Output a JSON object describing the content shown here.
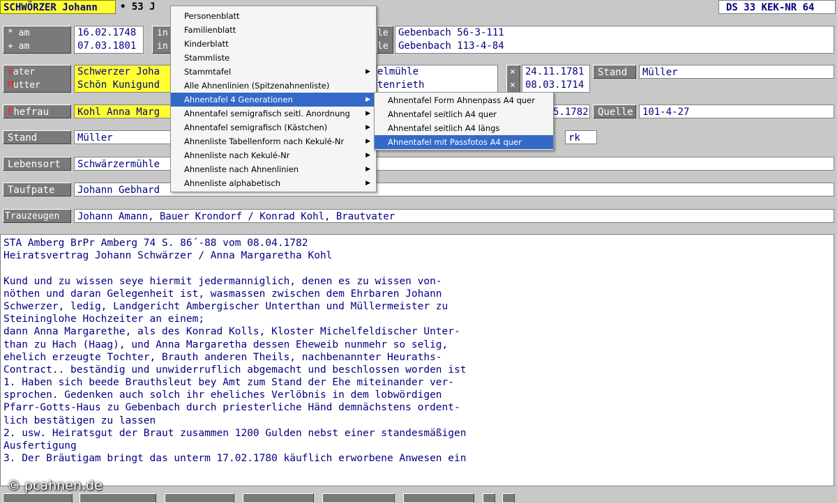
{
  "header": {
    "person_name": "SCHWÖRZER Johann",
    "age_fragment": "• 53 J",
    "ds_kek": "DS 33   KEK-NR 64"
  },
  "birth_death": {
    "labels": [
      "* am",
      "+ am"
    ],
    "dates": [
      "16.02.1748",
      "07.03.1801"
    ],
    "in_label_fragments": [
      "in",
      "in"
    ],
    "quelle_fragments": [
      "le",
      "le"
    ],
    "quelle_values": [
      "Gebenbach 56-3-111",
      "Gebenbach 113-4-84"
    ]
  },
  "parents": {
    "vater_label_first": "V",
    "vater_label_rest": "ater",
    "mutter_label_first": "M",
    "mutter_label_rest": "utter",
    "vater_name": "Schwerzer Joha",
    "mutter_name": "Schön Kunigund",
    "vater_place": "elmühle",
    "mutter_place": "tenrieth",
    "vater_marker": "×",
    "mutter_marker": "×",
    "vater_date": "24.11.1781",
    "mutter_date": "08.03.1714",
    "stand_label": "Stand",
    "stand_value": "Müller"
  },
  "spouse": {
    "label_first": "E",
    "label_rest": "hefrau",
    "name": "Kohl Anna Marg",
    "date_fragment": "5.1782",
    "quelle_label": "Quelle",
    "quelle_value": "101-4-27"
  },
  "stand": {
    "label": "Stand",
    "value": "Müller",
    "extra": "rk"
  },
  "lebensort": {
    "label": "Lebensort",
    "value": "Schwärzermühle"
  },
  "taufpate": {
    "label": "Taufpate",
    "value": "Johann Gebhard"
  },
  "trauzeugen": {
    "label": "Trauzeugen",
    "value": "Johann Amann, Bauer Krondorf / Konrad Kohl, Brautvater"
  },
  "notes": [
    "STA Amberg BrPr Amberg 74 S. 86´-88 vom 08.04.1782",
    "Heiratsvertrag Johann Schwärzer / Anna Margaretha Kohl",
    "",
    "Kund und zu wissen seye hiermit jedermanniglich, denen es zu wissen von-",
    "nöthen und daran Gelegenheit ist, wasmassen zwischen dem Ehrbaren Johann",
    "Schwerzer, ledig, Landgericht Ambergischer Unterthan und Müllermeister zu",
    "Steininglohe Hochzeiter an einem;",
    "dann Anna Margarethe, als des Konrad Kolls, Kloster Michelfeldischer Unter-",
    "than zu Hach (Haag), und Anna Margaretha dessen Eheweib nunmehr so selig,",
    "ehelich erzeugte Tochter, Brauth anderen Theils, nachbenannter Heuraths-",
    "Contract.. beständig und unwiderruflich abgemacht und beschlossen worden ist",
    "1. Haben sich beede Brauthsleut bey Amt zum Stand der Ehe miteinander ver-",
    "sprochen. Gedenken auch solch ihr eheliches Verlöbnis in dem lobwördigen",
    "Pfarr-Gotts-Haus zu Gebenbach durch priesterliche Händ demnächstens ordent-",
    "lich bestätigen zu lassen",
    "2. usw. Heiratsgut der Braut zusammen 1200 Gulden nebst einer standesmäßigen",
    "Ausfertigung",
    "3. Der Bräutigam bringt das unterm 17.02.1780 käuflich erworbene Anwesen ein"
  ],
  "context_menu": {
    "items": [
      {
        "label": "Personenblatt",
        "submenu": false
      },
      {
        "label": "Familienblatt",
        "submenu": false
      },
      {
        "label": "Kinderblatt",
        "submenu": false
      },
      {
        "label": "Stammliste",
        "submenu": false
      },
      {
        "label": "Stammtafel",
        "submenu": true
      },
      {
        "label": "Alle Ahnenlinien (Spitzenahnenliste)",
        "submenu": false
      },
      {
        "label": "Ahnentafel 4 Generationen",
        "submenu": true
      },
      {
        "label": "Ahnentafel semigrafisch seitl. Anordnung",
        "submenu": true
      },
      {
        "label": "Ahnentafel semigrafisch (Kästchen)",
        "submenu": true
      },
      {
        "label": "Ahnenliste Tabellenform nach Kekulé-Nr",
        "submenu": true
      },
      {
        "label": "Ahnenliste nach Kekulé-Nr",
        "submenu": true
      },
      {
        "label": "Ahnenliste nach Ahnenlinien",
        "submenu": true
      },
      {
        "label": "Ahnenliste alphabetisch",
        "submenu": true
      }
    ],
    "selected_index": 6,
    "arrow_glyph": "▶"
  },
  "submenu": {
    "items": [
      "Ahnentafel Form Ahnenpass A4 quer",
      "Ahnentafel seitlich  A4 quer",
      "Ahnentafel seitlich  A4 längs",
      "Ahnentafel mit Passfotos  A4 quer"
    ],
    "selected_index": 3
  },
  "watermark": "© pcahnen.de",
  "colors": {
    "highlight_yellow": "#ffff33",
    "label_gray": "#7a7a7a",
    "text_navy": "#000080",
    "menu_selection": "#3469c8",
    "label_accent_red": "#ff2020"
  }
}
